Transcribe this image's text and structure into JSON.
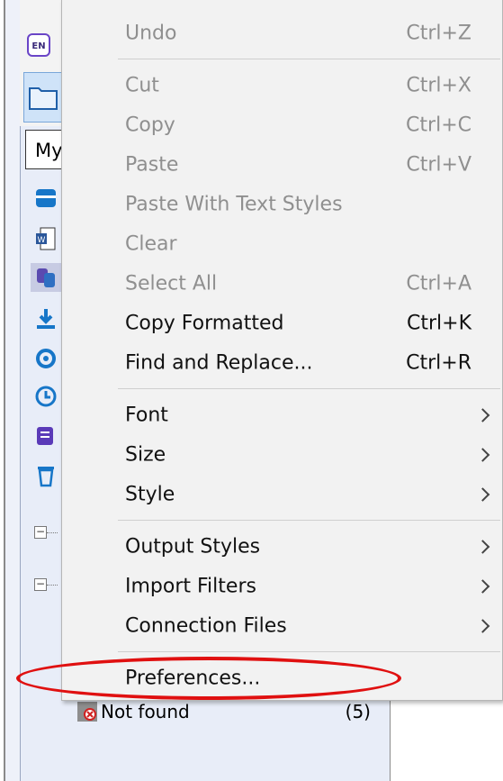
{
  "background_app": {
    "lang_badge": "EN",
    "library_box_text": "My",
    "not_found": {
      "label": "Not found",
      "count": "(5)"
    }
  },
  "menu": {
    "items": [
      {
        "label": "Undo",
        "shortcut": "Ctrl+Z",
        "enabled": false
      },
      {
        "label": "Cut",
        "shortcut": "Ctrl+X",
        "enabled": false
      },
      {
        "label": "Copy",
        "shortcut": "Ctrl+C",
        "enabled": false
      },
      {
        "label": "Paste",
        "shortcut": "Ctrl+V",
        "enabled": false
      },
      {
        "label": "Paste With Text Styles",
        "shortcut": "",
        "enabled": false
      },
      {
        "label": "Clear",
        "shortcut": "",
        "enabled": false
      },
      {
        "label": "Select All",
        "shortcut": "Ctrl+A",
        "enabled": false
      },
      {
        "label": "Copy Formatted",
        "shortcut": "Ctrl+K",
        "enabled": true
      },
      {
        "label": "Find and Replace...",
        "shortcut": "Ctrl+R",
        "enabled": true
      },
      {
        "label": "Font",
        "submenu": true,
        "enabled": true
      },
      {
        "label": "Size",
        "submenu": true,
        "enabled": true
      },
      {
        "label": "Style",
        "submenu": true,
        "enabled": true
      },
      {
        "label": "Output Styles",
        "submenu": true,
        "enabled": true
      },
      {
        "label": "Import Filters",
        "submenu": true,
        "enabled": true
      },
      {
        "label": "Connection Files",
        "submenu": true,
        "enabled": true
      },
      {
        "label": "Preferences...",
        "shortcut": "",
        "enabled": true
      }
    ]
  },
  "annotation": {
    "color": "#e01010",
    "target": "Preferences..."
  },
  "colors": {
    "menu_bg": "#f2f2f2",
    "disabled_text": "#8f8f8f",
    "enabled_text": "#111111"
  }
}
